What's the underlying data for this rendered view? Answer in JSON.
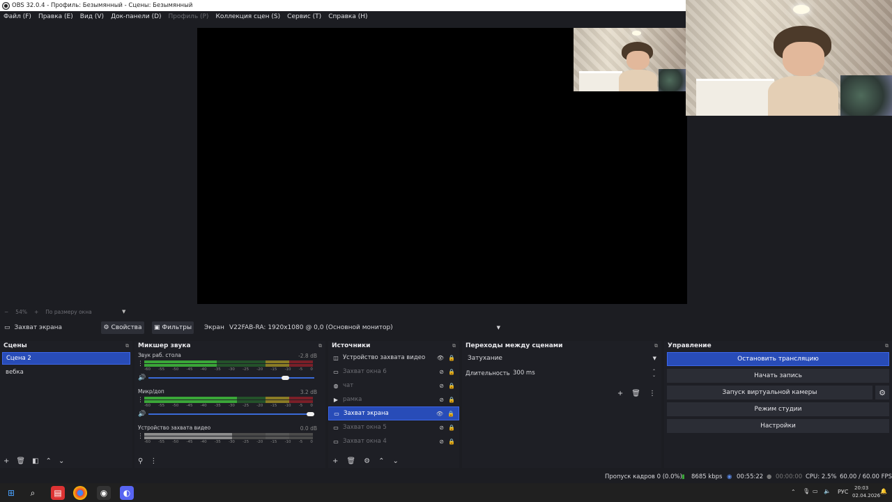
{
  "window": {
    "title": "OBS 32.0.4 - Профиль: Безымянный - Сцены: Безымянный"
  },
  "menu": [
    "Файл (F)",
    "Правка (E)",
    "Вид (V)",
    "Док-панели (D)",
    "Профиль (P)",
    "Коллекция сцен (S)",
    "Сервис (T)",
    "Справка (H)"
  ],
  "preview_bar": {
    "zoom": "54%",
    "zoom_plus": "+",
    "fit": "По размеру окна"
  },
  "source_bar": {
    "source_name": "Захват экрана",
    "properties": "Свойства",
    "filters": "Фильтры",
    "screen_label": "Экран",
    "screen_value": "V22FAB-RA: 1920x1080 @ 0,0 (Основной монитор)"
  },
  "scenes": {
    "title": "Сцены",
    "items": [
      "Сцена 2",
      "вебка"
    ],
    "selected": 0
  },
  "mixer": {
    "title": "Микшер звука",
    "channels": [
      {
        "name": "Звук раб. стола",
        "db": "-2.8 dB",
        "level": 0.43,
        "volume": 0.84
      },
      {
        "name": "Микр/доп",
        "db": "3.2 dB",
        "level": 0.55,
        "volume": 1.0
      },
      {
        "name": "Устройство захвата видео",
        "db": "0.0 dB",
        "level": 0.52,
        "volume": 1.0
      }
    ],
    "ticks": [
      "-60",
      "-55",
      "-50",
      "-45",
      "-40",
      "-35",
      "-30",
      "-25",
      "-20",
      "-15",
      "-10",
      "-5",
      "0"
    ]
  },
  "sources": {
    "title": "Источники",
    "items": [
      {
        "label": "Устройство захвата видео",
        "icon": "camera-icon",
        "visible": true
      },
      {
        "label": "Захват окна 6",
        "icon": "window-icon",
        "visible": false
      },
      {
        "label": "чат",
        "icon": "browser-icon",
        "visible": false
      },
      {
        "label": "рамка",
        "icon": "media-icon",
        "visible": false
      },
      {
        "label": "Захват экрана",
        "icon": "monitor-icon",
        "visible": true
      },
      {
        "label": "Захват окна 5",
        "icon": "window-icon",
        "visible": false
      },
      {
        "label": "Захват окна 4",
        "icon": "window-icon",
        "visible": false
      }
    ],
    "selected": 4
  },
  "transitions": {
    "title": "Переходы между сценами",
    "type": "Затухание",
    "duration_label": "Длительность",
    "duration_value": "300 ms"
  },
  "controls": {
    "title": "Управление",
    "stop_stream": "Остановить трансляцию",
    "start_record": "Начать запись",
    "virtual_cam": "Запуск виртуальной камеры",
    "studio_mode": "Режим студии",
    "settings": "Настройки"
  },
  "status": {
    "dropped": "Пропуск кадров 0 (0.0%)",
    "bitrate": "8685 kbps",
    "stream_time": "00:55:22",
    "rec_time": "00:00:00",
    "cpu": "CPU: 2.5%",
    "fps": "60.00 / 60.00 FPS"
  },
  "taskbar": {
    "lang": "РУС",
    "time": "20:03",
    "date": "02.04.2026"
  },
  "colors": {
    "accent": "#284cb8",
    "bg": "#1c1d22"
  }
}
